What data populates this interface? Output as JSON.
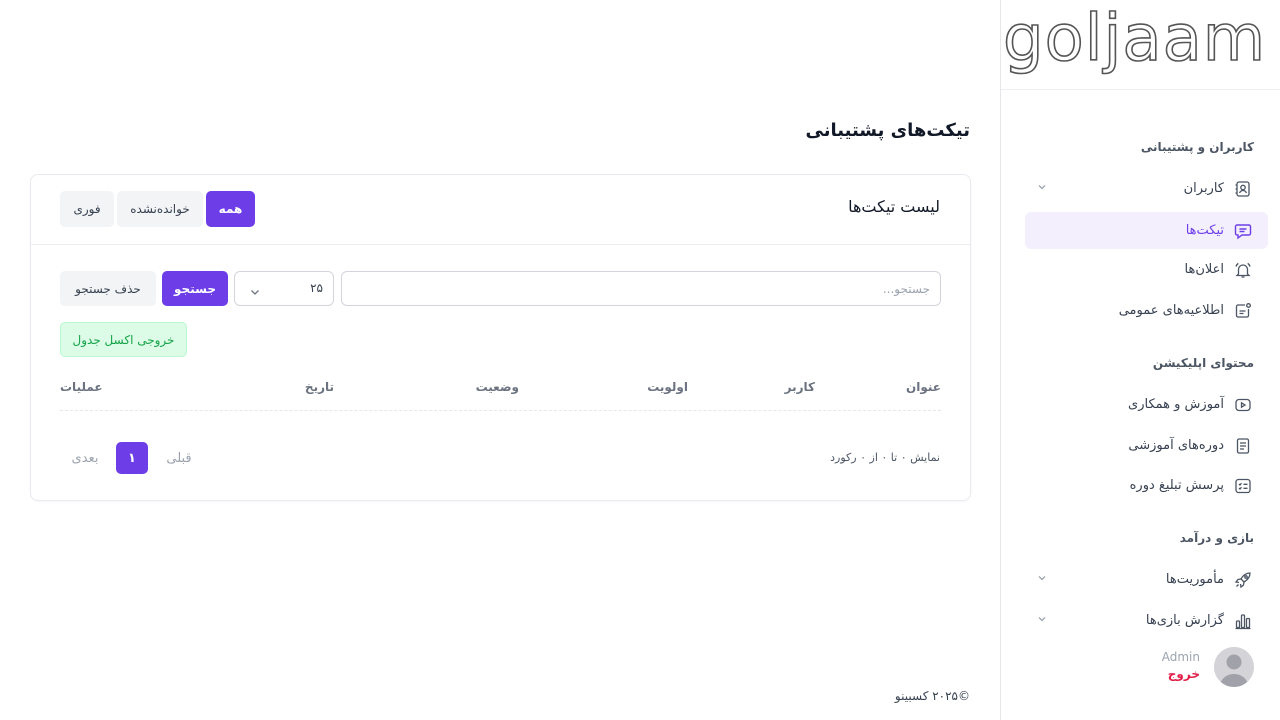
{
  "sidebar": {
    "logo": "goljaam",
    "sections": [
      {
        "title": "کاربران و پشتیبانی"
      },
      {
        "title": "محتوای اپلیکیشن"
      },
      {
        "title": "بازی و درآمد"
      }
    ],
    "items": [
      {
        "label": "کاربران",
        "icon": "users-icon",
        "has_submenu": true
      },
      {
        "label": "تیکت‌ها",
        "icon": "message-icon",
        "active": true
      },
      {
        "label": "اعلان‌ها",
        "icon": "bell-icon"
      },
      {
        "label": "اطلاعیه‌های عمومی",
        "icon": "announcement-icon"
      },
      {
        "label": "آموزش و همکاری",
        "icon": "video-icon"
      },
      {
        "label": "دوره‌های آموزشی",
        "icon": "book-icon"
      },
      {
        "label": "پرسش تبلیغ دوره",
        "icon": "list-icon"
      },
      {
        "label": "مأموریت‌ها",
        "icon": "rocket-icon",
        "has_submenu": true
      },
      {
        "label": "گزارش بازی‌ها",
        "icon": "chart-icon",
        "has_submenu": true
      }
    ],
    "user": {
      "name": "Admin",
      "logout": "خروج"
    }
  },
  "main": {
    "page_title": "تیکت‌های پشتیبانی",
    "card_title": "لیست تیکت‌ها",
    "filters": {
      "all": "همه",
      "unread": "خوانده‌نشده",
      "urgent": "فوری"
    },
    "search": {
      "placeholder": "جستجو...",
      "per_page": "۲۵",
      "search_button": "جستجو",
      "clear_button": "حذف جستجو"
    },
    "export_button": "خروجی اکسل جدول",
    "table": {
      "columns": [
        "عنوان",
        "کاربر",
        "اولویت",
        "وضعیت",
        "تاریخ",
        "عملیات"
      ]
    },
    "pagination": {
      "info": "نمایش ۰ تا ۰ از ۰ رکورد",
      "prev": "قبلی",
      "current": "۱",
      "next": "بعدی"
    }
  },
  "footer": {
    "text": "©۲۰۲۵ کسبینو"
  },
  "colors": {
    "accent": "#6d3ee8",
    "logout": "#e11d48",
    "export_bg": "#dcfce7",
    "export_text": "#16a34a"
  }
}
